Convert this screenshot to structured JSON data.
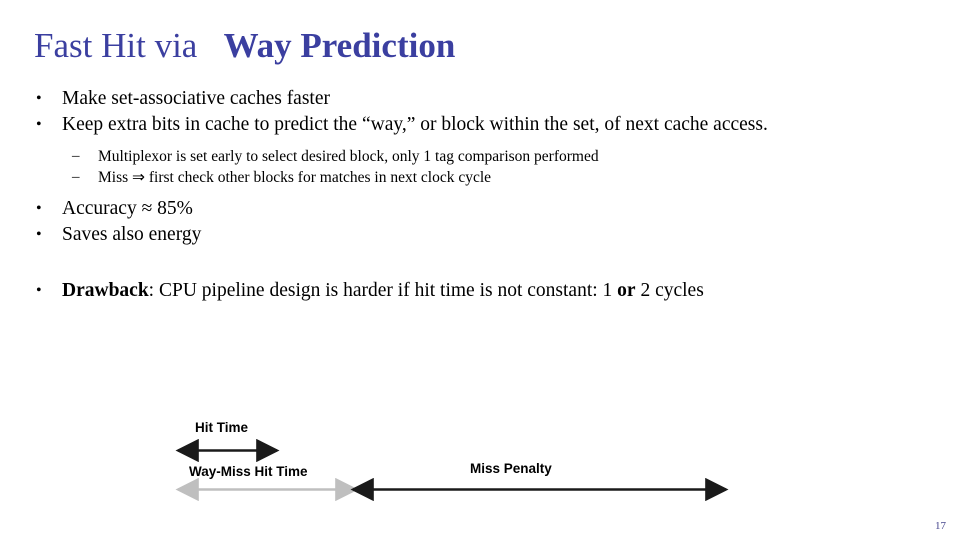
{
  "slide": {
    "title": {
      "part1": "Fast Hit via",
      "part2": "Way Prediction"
    },
    "bullets": [
      {
        "level": 1,
        "text": "Make set-associative caches faster"
      },
      {
        "level": 1,
        "text": "Keep extra bits in cache to predict the “way,” or block within the set, of next cache access."
      },
      {
        "level": 2,
        "text": "Multiplexor is set early to select desired block, only 1 tag comparison performed"
      },
      {
        "level": 2,
        "text": "Miss ⇒ first check other blocks for matches in next clock cycle"
      },
      {
        "level": 1,
        "text": "Accuracy ≈ 85%"
      },
      {
        "level": 1,
        "text": "Saves also energy"
      }
    ],
    "drawback": {
      "bold_lead": "Drawback",
      "rest": ": CPU pipeline design is harder if hit time is not constant:  1 ",
      "or": "or",
      "tail": " 2 cycles"
    },
    "bullet_glyph_l1": "•",
    "bullet_glyph_l2": "–",
    "diagram": {
      "labels": {
        "hit_time": "Hit Time",
        "way_miss_hit_time": "Way-Miss Hit Time",
        "miss_penalty": "Miss Penalty"
      },
      "colors": {
        "dark_arrow": "#1a1a1a",
        "light_arrow": "#bfbfbf"
      }
    },
    "page_number": "17"
  }
}
